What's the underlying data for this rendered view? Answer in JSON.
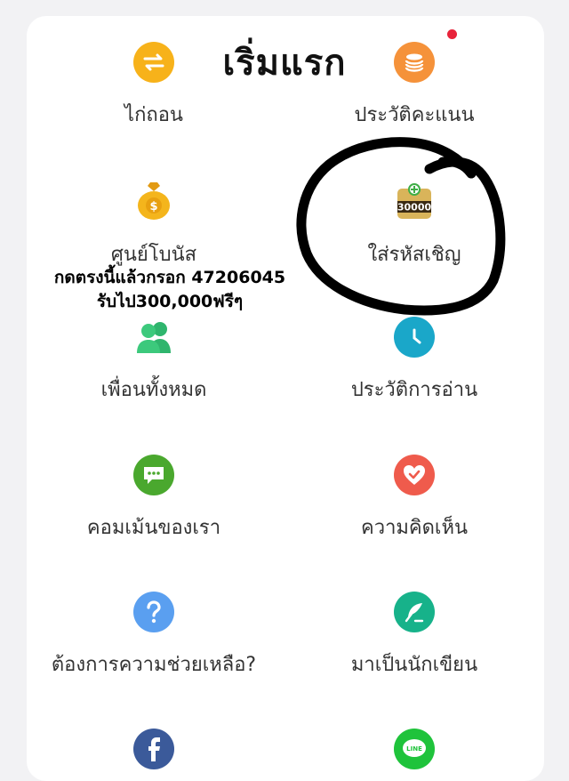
{
  "header": {
    "title": "เริ่มแรก"
  },
  "menu": {
    "items": [
      {
        "label": "ไก่ถอน",
        "icon": "swap-arrows-icon",
        "color": "#f7b21a"
      },
      {
        "label": "ประวัติคะแนน",
        "icon": "coin-stack-icon",
        "color": "#f5923a"
      },
      {
        "label": "ศูนย์โบนัส",
        "icon": "money-bag-icon",
        "color": "#f4b51c"
      },
      {
        "label": "ใส่รหัสเชิญ",
        "icon": "gift-30000-icon",
        "badge": "30000",
        "color": "#c8a24a"
      },
      {
        "label": "เพื่อนทั้งหมด",
        "icon": "friends-icon",
        "color": "#2fb56d"
      },
      {
        "label": "ประวัติการอ่าน",
        "icon": "clock-icon",
        "color": "#1aa7c9"
      },
      {
        "label": "คอมเม้นของเรา",
        "icon": "comment-icon",
        "color": "#4aa82e"
      },
      {
        "label": "ความคิดเห็น",
        "icon": "feedback-heart-icon",
        "color": "#ef5b4c"
      },
      {
        "label": "ต้องการความช่วยเหลือ?",
        "icon": "question-icon",
        "color": "#5a9ff0"
      },
      {
        "label": "มาเป็นนักเขียน",
        "icon": "quill-icon",
        "color": "#17b28a"
      },
      {
        "label": "",
        "icon": "facebook-icon",
        "color": "#3b5a9a"
      },
      {
        "label": "",
        "icon": "line-icon",
        "color": "#1fc33b"
      }
    ]
  },
  "overlay": {
    "line1": "กดตรงนี้แล้วกรอก 47206045",
    "line2": "รับไป300,000ฟรีๆ"
  },
  "colors": {
    "background": "#f2f2f4",
    "card": "#ffffff",
    "notification": "#e8233a",
    "scribble": "#000000"
  }
}
